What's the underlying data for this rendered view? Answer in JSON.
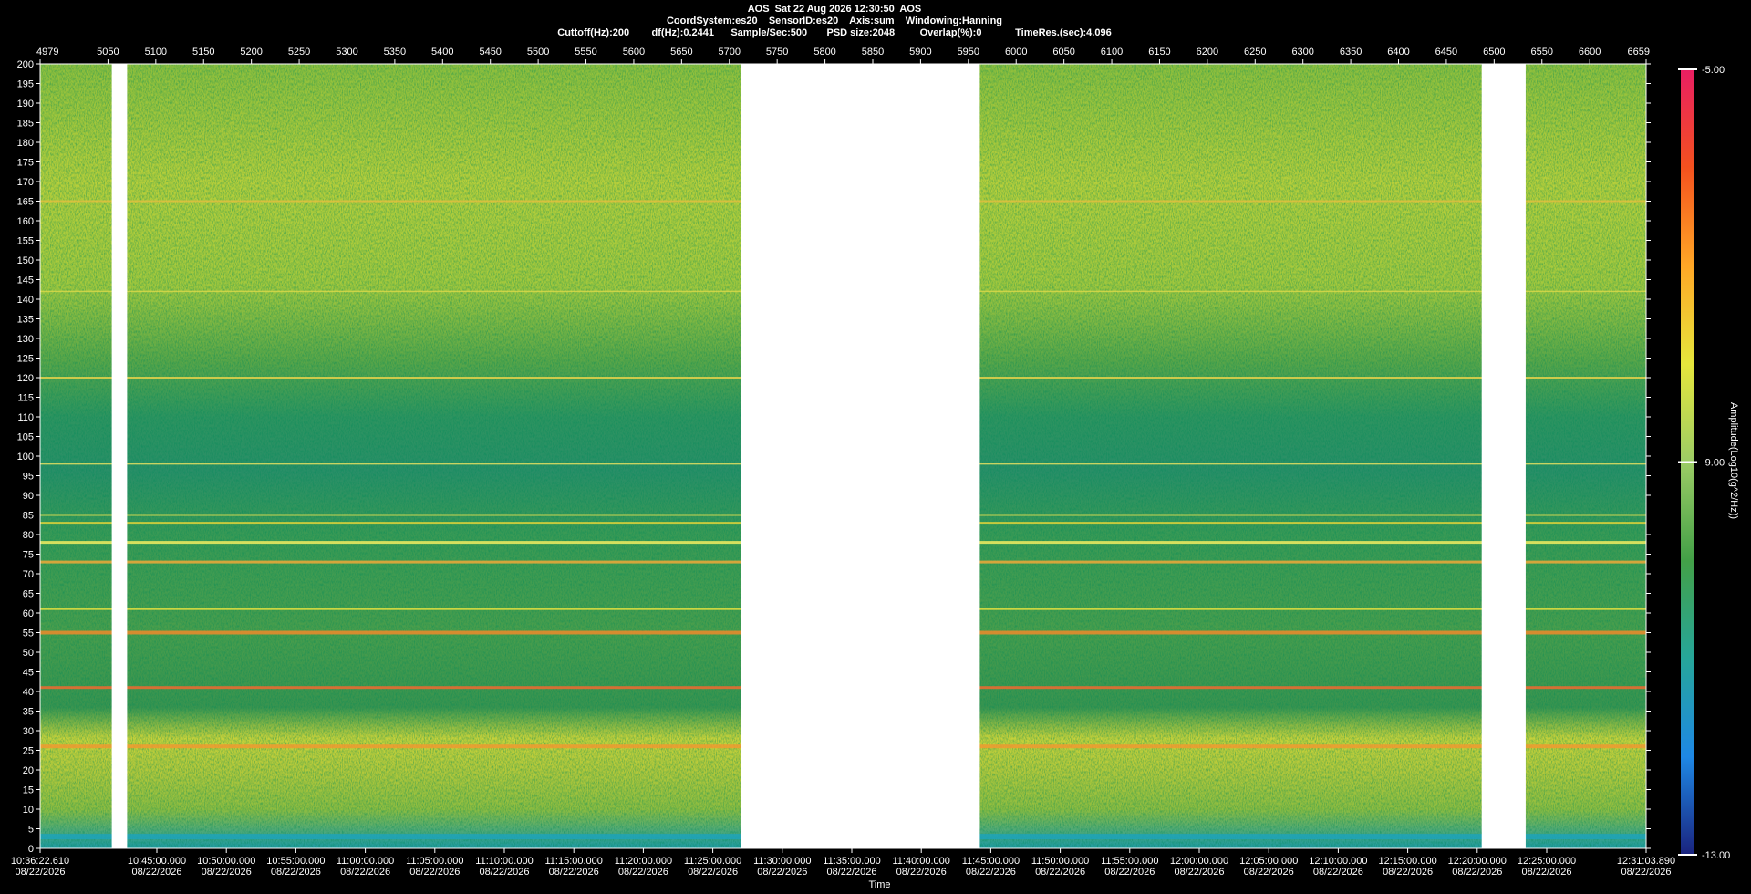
{
  "header": {
    "line1": "AOS  Sat 22 Aug 2026 12:30:50  AOS",
    "line2": "CoordSystem:es20    SensorID:es20    Axis:sum    Windowing:Hanning",
    "line3": "Cuttoff(Hz):200        df(Hz):0.2441      Sample/Sec:500       PSD size:2048         Overlap(%):0            TimeRes.(sec):4.096"
  },
  "chart_data": {
    "type": "heatmap",
    "title": "",
    "xlabel": "Time",
    "ylabel": "",
    "colorbar_label": "Amplitude(Log10(g^2/Hz))",
    "colorbar_range": [
      -13.0,
      -5.0
    ],
    "colorbar_tick_labels": [
      "-5.00",
      "-9.00",
      "-13.00"
    ],
    "colors": [
      "#1a237e",
      "#1e88e5",
      "#26a69a",
      "#43a047",
      "#9ccc65",
      "#e6e63c",
      "#ffa726",
      "#f4511e",
      "#e91e63"
    ],
    "ylim": [
      0,
      200
    ],
    "y_ticks": [
      0,
      5,
      10,
      15,
      20,
      25,
      30,
      35,
      40,
      45,
      50,
      55,
      60,
      65,
      70,
      75,
      80,
      85,
      90,
      95,
      100,
      105,
      110,
      115,
      120,
      125,
      130,
      135,
      140,
      145,
      150,
      155,
      160,
      165,
      170,
      175,
      180,
      185,
      190,
      195,
      200
    ],
    "top_axis_range": [
      4979,
      6659
    ],
    "top_ticks": [
      "4979",
      "5050",
      "5100",
      "5150",
      "5200",
      "5250",
      "5300",
      "5350",
      "5400",
      "5450",
      "5500",
      "5550",
      "5600",
      "5650",
      "5700",
      "5750",
      "5800",
      "5850",
      "5900",
      "5950",
      "6000",
      "6050",
      "6100",
      "6150",
      "6200",
      "6250",
      "6300",
      "6350",
      "6400",
      "6450",
      "6500",
      "6550",
      "6600",
      "6659"
    ],
    "bottom_ticks": [
      {
        "time": "10:36:22.610",
        "date": "08/22/2026"
      },
      {
        "time": "10:45:00.000",
        "date": "08/22/2026"
      },
      {
        "time": "10:50:00.000",
        "date": "08/22/2026"
      },
      {
        "time": "10:55:00.000",
        "date": "08/22/2026"
      },
      {
        "time": "11:00:00.000",
        "date": "08/22/2026"
      },
      {
        "time": "11:05:00.000",
        "date": "08/22/2026"
      },
      {
        "time": "11:10:00.000",
        "date": "08/22/2026"
      },
      {
        "time": "11:15:00.000",
        "date": "08/22/2026"
      },
      {
        "time": "11:20:00.000",
        "date": "08/22/2026"
      },
      {
        "time": "11:25:00.000",
        "date": "08/22/2026"
      },
      {
        "time": "11:30:00.000",
        "date": "08/22/2026"
      },
      {
        "time": "11:35:00.000",
        "date": "08/22/2026"
      },
      {
        "time": "11:40:00.000",
        "date": "08/22/2026"
      },
      {
        "time": "11:45:00.000",
        "date": "08/22/2026"
      },
      {
        "time": "11:50:00.000",
        "date": "08/22/2026"
      },
      {
        "time": "11:55:00.000",
        "date": "08/22/2026"
      },
      {
        "time": "12:00:00.000",
        "date": "08/22/2026"
      },
      {
        "time": "12:05:00.000",
        "date": "08/22/2026"
      },
      {
        "time": "12:10:00.000",
        "date": "08/22/2026"
      },
      {
        "time": "12:15:00.000",
        "date": "08/22/2026"
      },
      {
        "time": "12:20:00.000",
        "date": "08/22/2026"
      },
      {
        "time": "12:25:00.000",
        "date": "08/22/2026"
      },
      {
        "time": "12:31:03.890",
        "date": "08/22/2026"
      }
    ],
    "data_gaps": [
      [
        5054,
        5070
      ],
      [
        5712,
        5962
      ],
      [
        6487,
        6533
      ]
    ],
    "spectral_lines_hz": [
      3,
      26,
      41,
      55,
      61,
      73,
      78,
      83,
      85,
      98,
      120,
      142,
      165
    ]
  }
}
